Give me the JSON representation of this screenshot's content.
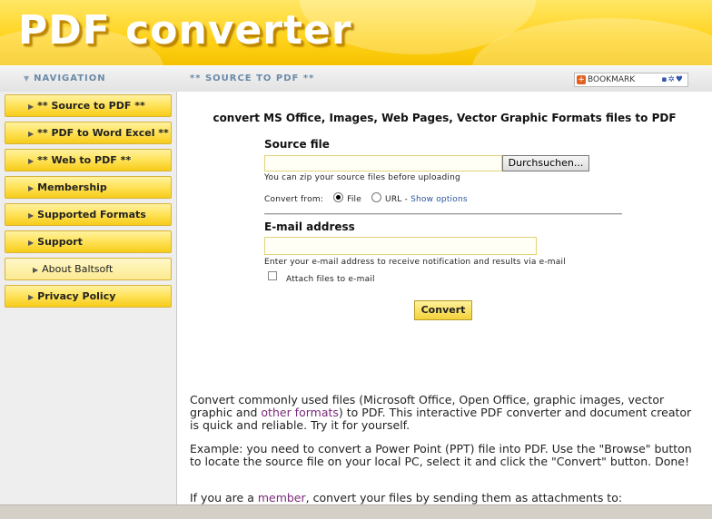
{
  "header": {
    "logo_text": "PDF converter"
  },
  "navbar": {
    "heading": "NAVIGATION",
    "breadcrumb": "** SOURCE TO PDF **",
    "bookmark_label": "BOOKMARK",
    "bookmark_icons": "▪✲♥"
  },
  "sidebar": {
    "items": [
      {
        "label": "** Source to PDF **"
      },
      {
        "label": "** PDF to Word Excel **"
      },
      {
        "label": "** Web to PDF **"
      },
      {
        "label": "Membership"
      },
      {
        "label": "Supported Formats"
      },
      {
        "label": "Support"
      },
      {
        "label": "About Baltsoft"
      },
      {
        "label": "Privacy Policy"
      }
    ]
  },
  "main": {
    "title": "convert MS Office, Images, Web Pages, Vector Graphic Formats files to PDF",
    "source_label": "Source file",
    "source_value": "",
    "browse_label": "Durchsuchen...",
    "zip_hint": "You can zip your source files before uploading",
    "convert_from_label": "Convert from:",
    "option_file": "File",
    "option_url": "URL -",
    "show_options": "Show options",
    "email_label": "E-mail address",
    "email_value": "",
    "email_hint": "Enter your e-mail address to receive notification and results via e-mail",
    "attach_label": "Attach files to e-mail",
    "convert_button": "Convert",
    "para1_a": "Convert commonly used files (Microsoft Office, Open Office, graphic images, vector graphic and ",
    "para1_link": "other formats",
    "para1_b": ") to PDF. This interactive PDF converter and document creator is quick and reliable. Try it for yourself.",
    "para2": "Example: you need to convert a Power Point (PPT) file into PDF. Use the \"Browse\" button to locate the source file on your local PC, select it and click the \"Convert\" button. Done!",
    "para3_a": "If you are a ",
    "para3_link": "member",
    "para3_b": ", convert your files by sending them as attachments to:"
  }
}
